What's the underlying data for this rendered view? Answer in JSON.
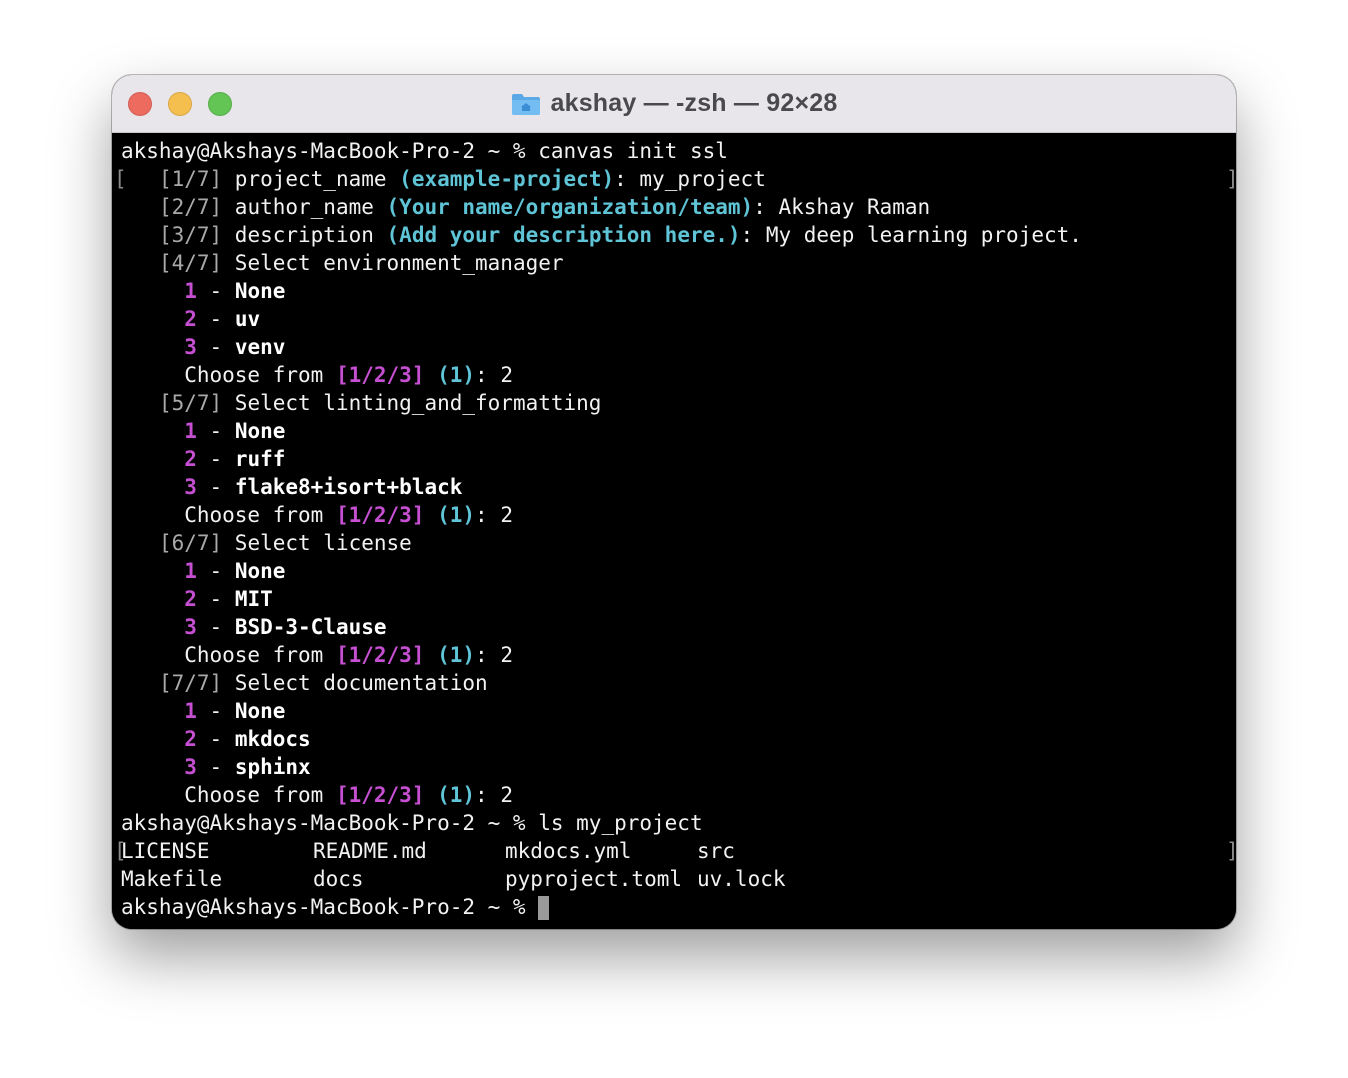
{
  "window": {
    "title": "akshay — -zsh — 92×28",
    "folder_icon": "home-folder-icon"
  },
  "colors": {
    "cyan": "#5ec4d6",
    "magenta": "#c64fd2",
    "text": "#f2f2f2",
    "dim": "#a9a9a9"
  },
  "prompt": "akshay@Akshays-MacBook-Pro-2 ~ %",
  "cmd1": "canvas init ssl",
  "bracket_open": "[",
  "bracket_close": "]",
  "q1": {
    "step": "[1/7]",
    "label": "project_name",
    "hint": "(example-project)",
    "colon": ":",
    "answer": "my_project"
  },
  "q2": {
    "step": "[2/7]",
    "label": "author_name",
    "hint": "(Your name/organization/team)",
    "colon": ":",
    "answer": "Akshay Raman"
  },
  "q3": {
    "step": "[3/7]",
    "label": "description",
    "hint": "(Add your description here.)",
    "colon": ":",
    "answer": "My deep learning project."
  },
  "q4": {
    "step": "[4/7]",
    "label": "Select environment_manager",
    "options": [
      {
        "num": "1",
        "name": "None"
      },
      {
        "num": "2",
        "name": "uv"
      },
      {
        "num": "3",
        "name": "venv"
      }
    ]
  },
  "q5": {
    "step": "[5/7]",
    "label": "Select linting_and_formatting",
    "options": [
      {
        "num": "1",
        "name": "None"
      },
      {
        "num": "2",
        "name": "ruff"
      },
      {
        "num": "3",
        "name": "flake8+isort+black"
      }
    ]
  },
  "q6": {
    "step": "[6/7]",
    "label": "Select license",
    "options": [
      {
        "num": "1",
        "name": "None"
      },
      {
        "num": "2",
        "name": "MIT"
      },
      {
        "num": "3",
        "name": "BSD-3-Clause"
      }
    ]
  },
  "q7": {
    "step": "[7/7]",
    "label": "Select documentation",
    "options": [
      {
        "num": "1",
        "name": "None"
      },
      {
        "num": "2",
        "name": "mkdocs"
      },
      {
        "num": "3",
        "name": "sphinx"
      }
    ]
  },
  "choose": {
    "text": "Choose from",
    "choices": "[1/2/3]",
    "default": "(1)",
    "colon": ":",
    "answer": "2"
  },
  "dash": "-",
  "cmd2": "ls my_project",
  "ls_files": [
    [
      "LICENSE",
      "README.md",
      "mkdocs.yml",
      "src"
    ],
    [
      "Makefile",
      "docs",
      "pyproject.toml",
      "uv.lock"
    ]
  ]
}
